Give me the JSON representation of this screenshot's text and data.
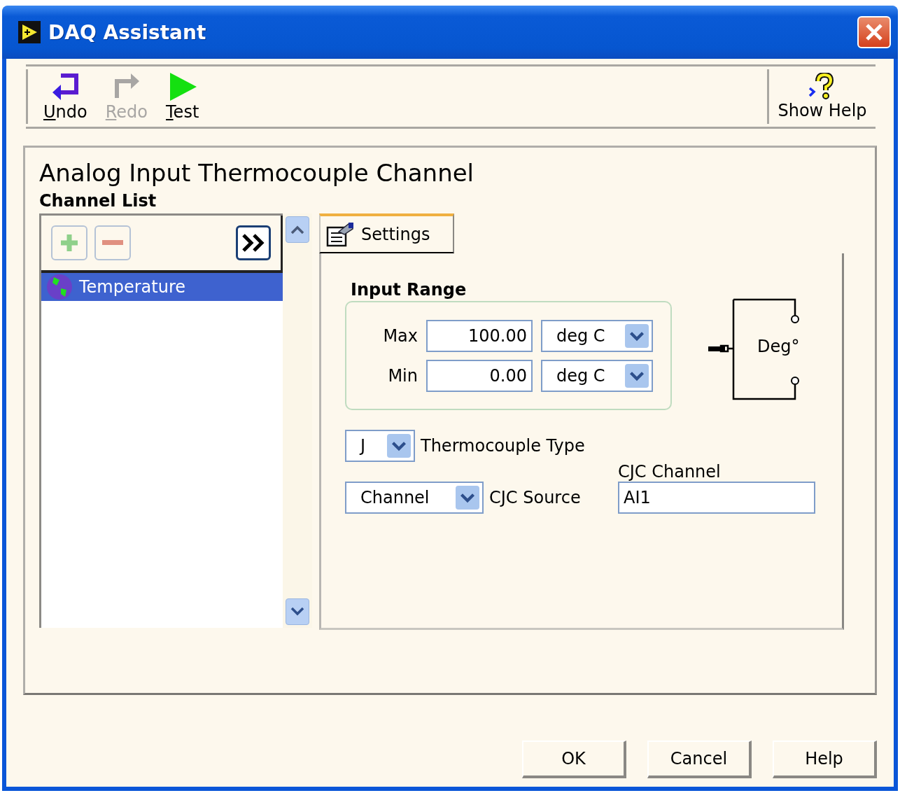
{
  "window": {
    "title": "DAQ Assistant"
  },
  "toolbar": [
    {
      "label": "Undo",
      "kind": "undo",
      "disabled": false
    },
    {
      "label": "Redo",
      "kind": "redo",
      "disabled": true
    },
    {
      "label": "Test",
      "kind": "test",
      "disabled": false
    }
  ],
  "help_button": {
    "label": "Show Help"
  },
  "heading": "Analog Input Thermocouple Channel",
  "channel_list": {
    "label": "Channel List",
    "items": [
      {
        "name": "Temperature",
        "selected": true
      }
    ]
  },
  "tabs": [
    {
      "label": "Settings",
      "selected": true
    }
  ],
  "input_range": {
    "title": "Input Range",
    "rows": [
      {
        "label": "Max",
        "value": "100.00",
        "unit": "deg C"
      },
      {
        "label": "Min",
        "value": "0.00",
        "unit": "deg C"
      }
    ]
  },
  "diagram": {
    "label": "Deg°"
  },
  "thermocouple_type": {
    "value": "J",
    "label": "Thermocouple Type"
  },
  "cjc_source": {
    "value": "Channel",
    "label": "CJC Source"
  },
  "cjc_channel": {
    "label": "CJC Channel",
    "value": "AI1"
  },
  "buttons": [
    "OK",
    "Cancel",
    "Help"
  ]
}
